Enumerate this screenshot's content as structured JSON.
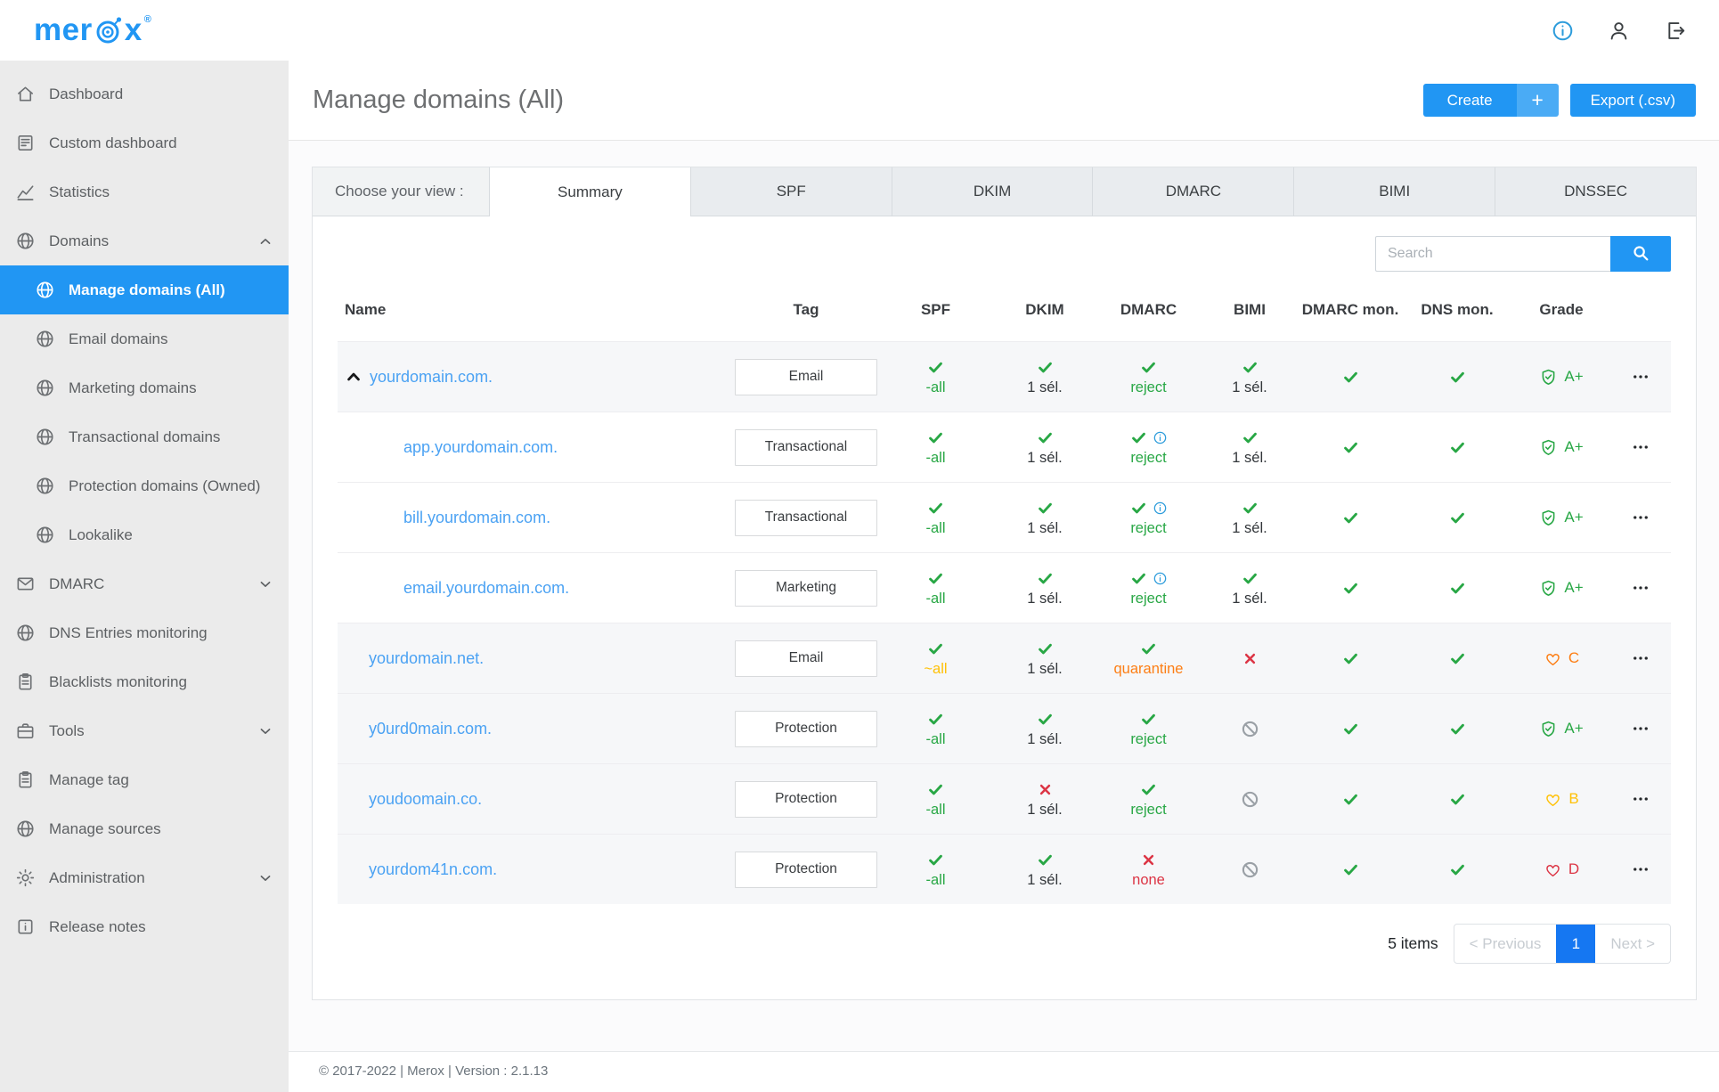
{
  "colors": {
    "accent": "#2196f3",
    "link": "#4ba2f3",
    "green": "#28a745",
    "red": "#dc3545",
    "orange": "#fd7e14",
    "yellow": "#ffc107",
    "gray": "#9aa0a6",
    "info": "#2d9cdb",
    "dark": "#33373b"
  },
  "brand": {
    "logo_text_pre": "mer",
    "logo_text_post": "x",
    "registered_mark": "®"
  },
  "sidebar": {
    "items": [
      {
        "label": "Dashboard",
        "icon": "home",
        "child": false,
        "chevron": null,
        "active": false
      },
      {
        "label": "Custom dashboard",
        "icon": "doc",
        "child": false,
        "chevron": null,
        "active": false
      },
      {
        "label": "Statistics",
        "icon": "chart",
        "child": false,
        "chevron": null,
        "active": false
      },
      {
        "label": "Domains",
        "icon": "globe",
        "child": false,
        "chevron": "up",
        "active": false
      },
      {
        "label": "Manage domains (All)",
        "icon": "globe",
        "child": true,
        "chevron": null,
        "active": true
      },
      {
        "label": "Email domains",
        "icon": "globe",
        "child": true,
        "chevron": null,
        "active": false
      },
      {
        "label": "Marketing domains",
        "icon": "globe",
        "child": true,
        "chevron": null,
        "active": false
      },
      {
        "label": "Transactional domains",
        "icon": "globe",
        "child": true,
        "chevron": null,
        "active": false
      },
      {
        "label": "Protection domains (Owned)",
        "icon": "globe",
        "child": true,
        "chevron": null,
        "active": false
      },
      {
        "label": "Lookalike",
        "icon": "globe",
        "child": true,
        "chevron": null,
        "active": false
      },
      {
        "label": "DMARC",
        "icon": "mail",
        "child": false,
        "chevron": "down",
        "active": false
      },
      {
        "label": "DNS Entries monitoring",
        "icon": "globe",
        "child": false,
        "chevron": null,
        "active": false
      },
      {
        "label": "Blacklists monitoring",
        "icon": "clipboard",
        "child": false,
        "chevron": null,
        "active": false
      },
      {
        "label": "Tools",
        "icon": "tools",
        "child": false,
        "chevron": "down",
        "active": false
      },
      {
        "label": "Manage tag",
        "icon": "clipboard",
        "child": false,
        "chevron": null,
        "active": false
      },
      {
        "label": "Manage sources",
        "icon": "globe",
        "child": false,
        "chevron": null,
        "active": false
      },
      {
        "label": "Administration",
        "icon": "gear",
        "child": false,
        "chevron": "down",
        "active": false
      },
      {
        "label": "Release notes",
        "icon": "notes",
        "child": false,
        "chevron": null,
        "active": false
      }
    ]
  },
  "page": {
    "title": "Manage domains (All)",
    "create_button": {
      "label": "Create",
      "plus": "+"
    },
    "export_button": "Export (.csv)"
  },
  "view_tabs": {
    "label": "Choose your view :",
    "active": "Summary",
    "tabs": [
      "Summary",
      "SPF",
      "DKIM",
      "DMARC",
      "BIMI",
      "DNSSEC"
    ]
  },
  "search": {
    "placeholder": "Search"
  },
  "table": {
    "columns": [
      "Name",
      "Tag",
      "SPF",
      "DKIM",
      "DMARC",
      "BIMI",
      "DMARC mon.",
      "DNS mon.",
      "Grade",
      ""
    ],
    "rows": [
      {
        "name": "yourdomain.com.",
        "level": "parent",
        "expander": true,
        "tag": "Email",
        "spf": {
          "icon": "check",
          "text": "-all",
          "color": "green"
        },
        "dkim": {
          "icon": "check",
          "text": "1 sél.",
          "color": "dark"
        },
        "dmarc": {
          "icon": "check",
          "info": false,
          "text": "reject",
          "color": "green"
        },
        "bimi": {
          "icon": "check",
          "text": "1 sél.",
          "color": "dark"
        },
        "dmarc_mon": {
          "icon": "check"
        },
        "dns_mon": {
          "icon": "check"
        },
        "grade": {
          "icon": "shield",
          "label": "A+",
          "color": "green"
        }
      },
      {
        "name": "app.yourdomain.com.",
        "level": "child",
        "expander": false,
        "tag": "Transactional",
        "spf": {
          "icon": "check",
          "text": "-all",
          "color": "green"
        },
        "dkim": {
          "icon": "check",
          "text": "1 sél.",
          "color": "dark"
        },
        "dmarc": {
          "icon": "check",
          "info": true,
          "text": "reject",
          "color": "green"
        },
        "bimi": {
          "icon": "check",
          "text": "1 sél.",
          "color": "dark"
        },
        "dmarc_mon": {
          "icon": "check"
        },
        "dns_mon": {
          "icon": "check"
        },
        "grade": {
          "icon": "shield",
          "label": "A+",
          "color": "green"
        }
      },
      {
        "name": "bill.yourdomain.com.",
        "level": "child",
        "expander": false,
        "tag": "Transactional",
        "spf": {
          "icon": "check",
          "text": "-all",
          "color": "green"
        },
        "dkim": {
          "icon": "check",
          "text": "1 sél.",
          "color": "dark"
        },
        "dmarc": {
          "icon": "check",
          "info": true,
          "text": "reject",
          "color": "green"
        },
        "bimi": {
          "icon": "check",
          "text": "1 sél.",
          "color": "dark"
        },
        "dmarc_mon": {
          "icon": "check"
        },
        "dns_mon": {
          "icon": "check"
        },
        "grade": {
          "icon": "shield",
          "label": "A+",
          "color": "green"
        }
      },
      {
        "name": "email.yourdomain.com.",
        "level": "child",
        "expander": false,
        "tag": "Marketing",
        "spf": {
          "icon": "check",
          "text": "-all",
          "color": "green"
        },
        "dkim": {
          "icon": "check",
          "text": "1 sél.",
          "color": "dark"
        },
        "dmarc": {
          "icon": "check",
          "info": true,
          "text": "reject",
          "color": "green"
        },
        "bimi": {
          "icon": "check",
          "text": "1 sél.",
          "color": "dark"
        },
        "dmarc_mon": {
          "icon": "check"
        },
        "dns_mon": {
          "icon": "check"
        },
        "grade": {
          "icon": "shield",
          "label": "A+",
          "color": "green"
        }
      },
      {
        "name": "yourdomain.net.",
        "level": "parent",
        "expander": false,
        "tag": "Email",
        "spf": {
          "icon": "check",
          "text": "~all",
          "color": "yellow"
        },
        "dkim": {
          "icon": "check",
          "text": "1 sél.",
          "color": "dark"
        },
        "dmarc": {
          "icon": "check",
          "info": false,
          "text": "quarantine",
          "color": "orange"
        },
        "bimi": {
          "icon": "x",
          "text": null
        },
        "dmarc_mon": {
          "icon": "check"
        },
        "dns_mon": {
          "icon": "check"
        },
        "grade": {
          "icon": "heart",
          "label": "C",
          "color": "orange"
        }
      },
      {
        "name": "y0urd0main.com.",
        "level": "parent",
        "expander": false,
        "tag": "Protection",
        "spf": {
          "icon": "check",
          "text": "-all",
          "color": "green"
        },
        "dkim": {
          "icon": "check",
          "text": "1 sél.",
          "color": "dark"
        },
        "dmarc": {
          "icon": "check",
          "info": false,
          "text": "reject",
          "color": "green"
        },
        "bimi": {
          "icon": "prohibited",
          "text": null
        },
        "dmarc_mon": {
          "icon": "check"
        },
        "dns_mon": {
          "icon": "check"
        },
        "grade": {
          "icon": "shield",
          "label": "A+",
          "color": "green"
        }
      },
      {
        "name": "youdoomain.co.",
        "level": "parent",
        "expander": false,
        "tag": "Protection",
        "spf": {
          "icon": "check",
          "text": "-all",
          "color": "green"
        },
        "dkim": {
          "icon": "x",
          "text": "1 sél.",
          "color": "dark"
        },
        "dmarc": {
          "icon": "check",
          "info": false,
          "text": "reject",
          "color": "green"
        },
        "bimi": {
          "icon": "prohibited",
          "text": null
        },
        "dmarc_mon": {
          "icon": "check"
        },
        "dns_mon": {
          "icon": "check"
        },
        "grade": {
          "icon": "heart",
          "label": "B",
          "color": "yellow"
        }
      },
      {
        "name": "yourdom41n.com.",
        "level": "parent",
        "expander": false,
        "tag": "Protection",
        "spf": {
          "icon": "check",
          "text": "-all",
          "color": "green"
        },
        "dkim": {
          "icon": "check",
          "text": "1 sél.",
          "color": "dark"
        },
        "dmarc": {
          "icon": "x",
          "info": false,
          "text": "none",
          "color": "red"
        },
        "bimi": {
          "icon": "prohibited",
          "text": null
        },
        "dmarc_mon": {
          "icon": "check"
        },
        "dns_mon": {
          "icon": "check"
        },
        "grade": {
          "icon": "heart",
          "label": "D",
          "color": "red"
        }
      }
    ]
  },
  "pagination": {
    "items_count": "5 items",
    "previous_label": "< Previous",
    "current_page": "1",
    "next_label": "Next >"
  },
  "footer": {
    "copyright": "© 2017-2022 | Merox | Version : 2.1.13"
  }
}
